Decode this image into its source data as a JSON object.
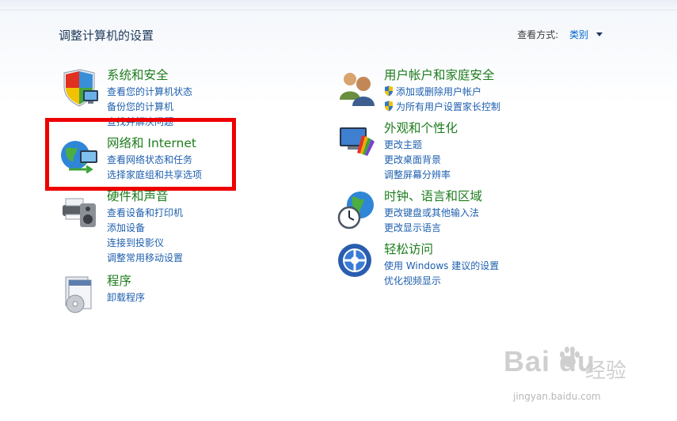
{
  "header": {
    "title": "调整计算机的设置",
    "view_by_label": "查看方式:",
    "view_by_value": "类别"
  },
  "categories": [
    {
      "id": "system",
      "heading": "系统和安全",
      "icon": "shield-computer-icon",
      "links": [
        {
          "label": "查看您的计算机状态"
        },
        {
          "label": "备份您的计算机"
        },
        {
          "label": "查找并解决问题"
        }
      ]
    },
    {
      "id": "network",
      "heading": "网络和 Internet",
      "icon": "globe-network-icon",
      "links": [
        {
          "label": "查看网络状态和任务"
        },
        {
          "label": "选择家庭组和共享选项"
        }
      ]
    },
    {
      "id": "hardware",
      "heading": "硬件和声音",
      "icon": "printer-speaker-icon",
      "links": [
        {
          "label": "查看设备和打印机"
        },
        {
          "label": "添加设备"
        },
        {
          "label": "连接到投影仪"
        },
        {
          "label": "调整常用移动设置"
        }
      ]
    },
    {
      "id": "programs",
      "heading": "程序",
      "icon": "programs-disc-icon",
      "links": [
        {
          "label": "卸载程序"
        }
      ]
    },
    {
      "id": "users",
      "heading": "用户帐户和家庭安全",
      "icon": "users-icon",
      "links": [
        {
          "label": "添加或删除用户帐户",
          "shield": true
        },
        {
          "label": "为所有用户设置家长控制",
          "shield": true
        }
      ]
    },
    {
      "id": "appearance",
      "heading": "外观和个性化",
      "icon": "monitor-palette-icon",
      "links": [
        {
          "label": "更改主题"
        },
        {
          "label": "更改桌面背景"
        },
        {
          "label": "调整屏幕分辨率"
        }
      ]
    },
    {
      "id": "clock",
      "heading": "时钟、语言和区域",
      "icon": "clock-globe-icon",
      "links": [
        {
          "label": "更改键盘或其他输入法"
        },
        {
          "label": "更改显示语言"
        }
      ]
    },
    {
      "id": "ease",
      "heading": "轻松访问",
      "icon": "ease-of-access-icon",
      "links": [
        {
          "label": "使用 Windows 建议的设置"
        },
        {
          "label": "优化视频显示"
        }
      ]
    }
  ],
  "watermark": {
    "logo": "Bai du",
    "text": "经验",
    "url": "jingyan.baidu.com"
  },
  "colors": {
    "heading_green": "#1e7d1e",
    "link_blue": "#1e5fae",
    "highlight_red": "#ee0000",
    "title_navy": "#1e395b"
  }
}
